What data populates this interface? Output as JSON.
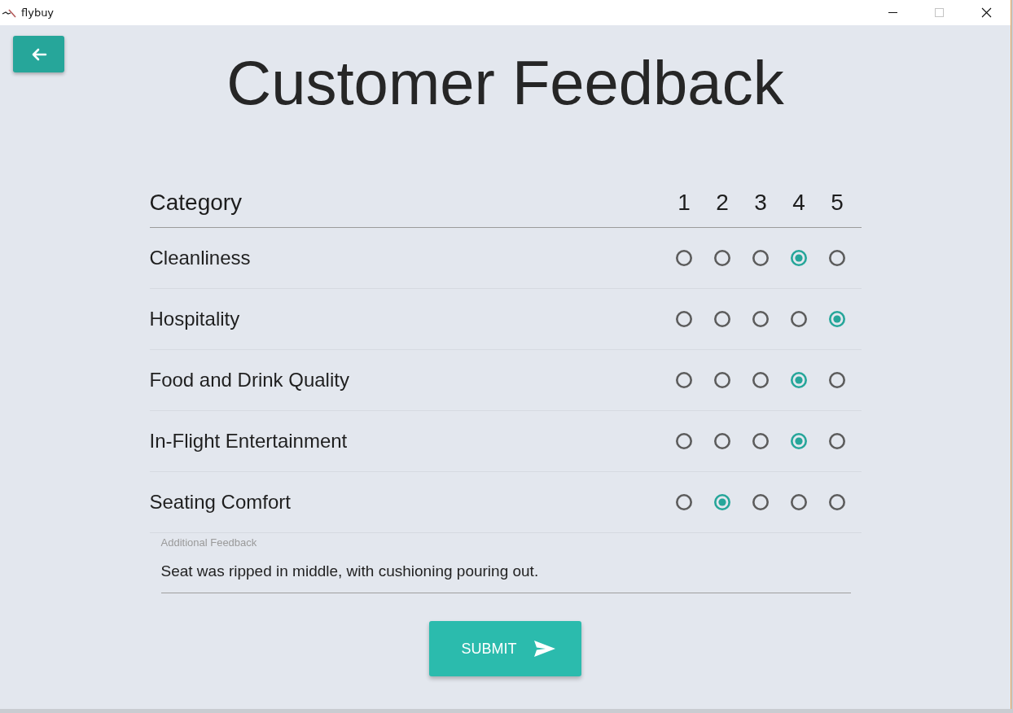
{
  "window": {
    "title": "flybuy"
  },
  "heading": "Customer Feedback",
  "table": {
    "columns": [
      "Category",
      "1",
      "2",
      "3",
      "4",
      "5"
    ],
    "rows": [
      {
        "category": "Cleanliness",
        "options": [
          {
            "selected": false
          },
          {
            "selected": false
          },
          {
            "selected": false
          },
          {
            "selected": true
          },
          {
            "selected": false
          }
        ]
      },
      {
        "category": "Hospitality",
        "options": [
          {
            "selected": false
          },
          {
            "selected": false
          },
          {
            "selected": false
          },
          {
            "selected": false
          },
          {
            "selected": true
          }
        ]
      },
      {
        "category": "Food and Drink Quality",
        "options": [
          {
            "selected": false
          },
          {
            "selected": false
          },
          {
            "selected": false
          },
          {
            "selected": true
          },
          {
            "selected": false
          }
        ]
      },
      {
        "category": "In-Flight Entertainment",
        "options": [
          {
            "selected": false
          },
          {
            "selected": false
          },
          {
            "selected": false
          },
          {
            "selected": true
          },
          {
            "selected": false
          }
        ]
      },
      {
        "category": "Seating Comfort",
        "options": [
          {
            "selected": false
          },
          {
            "selected": true
          },
          {
            "selected": false
          },
          {
            "selected": false
          },
          {
            "selected": false
          }
        ]
      }
    ]
  },
  "feedback": {
    "label": "Additional Feedback",
    "value": "Seat was ripped in middle, with cushioning pouring out."
  },
  "submit_button": {
    "label": "SUBMIT"
  }
}
